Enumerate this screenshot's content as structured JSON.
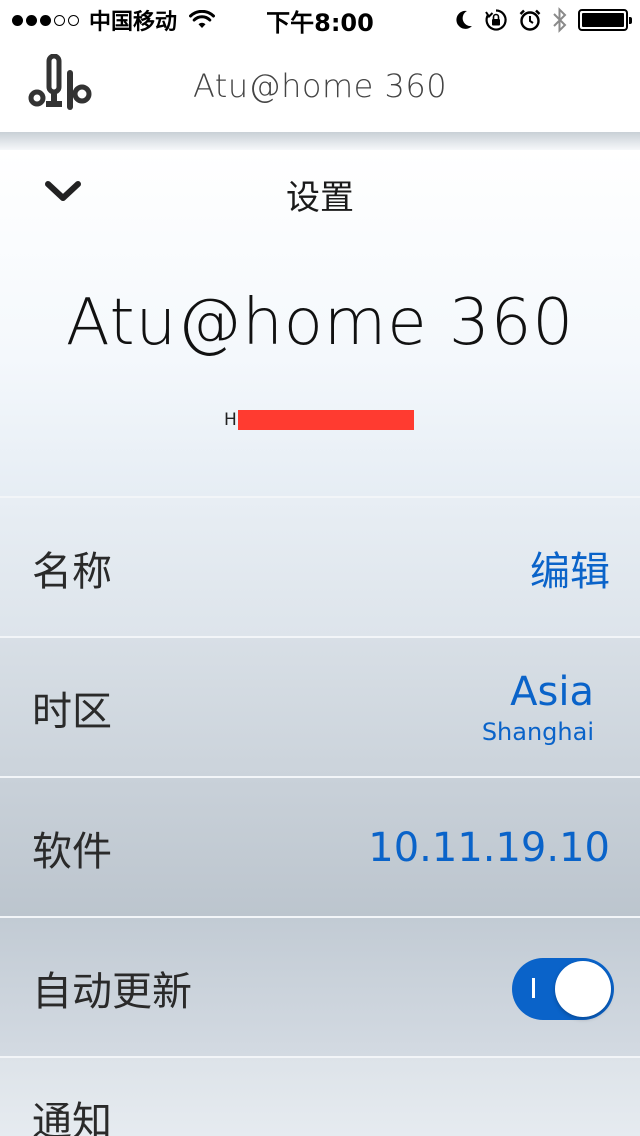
{
  "status_bar": {
    "carrier": "中国移动",
    "time": "下午8:00",
    "icons": [
      "signal-dots-icon",
      "wifi-icon",
      "moon-icon",
      "rotation-lock-icon",
      "alarm-icon",
      "bluetooth-icon",
      "battery-icon"
    ]
  },
  "header": {
    "title": "Atu@home 360",
    "logo_icon": "brand-logo-icon"
  },
  "settings": {
    "title": "设置",
    "back_icon": "chevron-down-icon",
    "device_name": "Atu@home 360",
    "serial_prefix": "H"
  },
  "rows": {
    "name": {
      "label": "名称",
      "value": "编辑"
    },
    "timezone": {
      "label": "时区",
      "region": "Asia",
      "city": "Shanghai"
    },
    "software": {
      "label": "软件",
      "version": "10.11.19.10"
    },
    "auto_update": {
      "label": "自动更新",
      "state": "on"
    },
    "notifications": {
      "label": "通知"
    }
  },
  "colors": {
    "accent": "#0a63c9",
    "redaction": "#ff3b30"
  }
}
